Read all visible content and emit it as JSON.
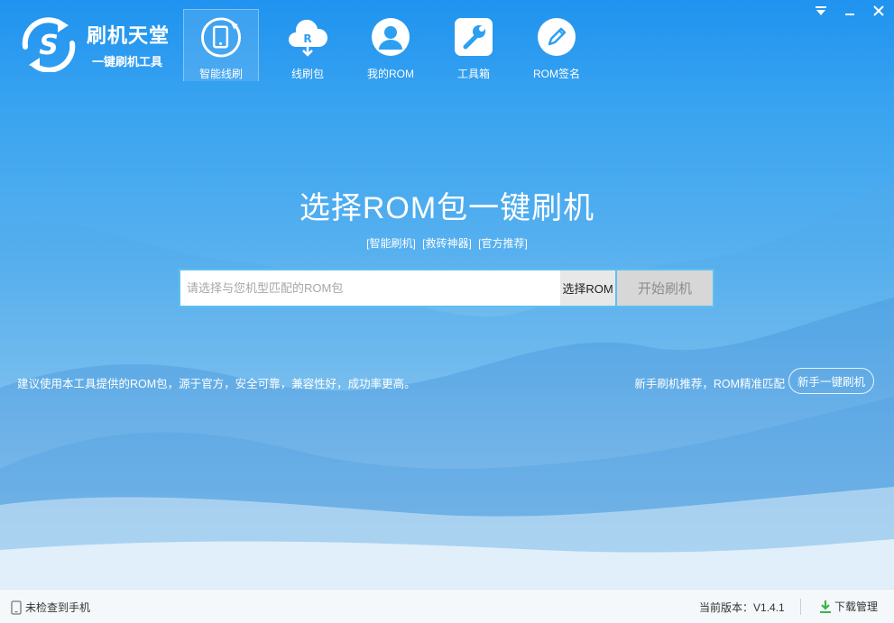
{
  "logo": {
    "title": "刷机天堂",
    "subtitle": "一键刷机工具"
  },
  "nav": [
    {
      "label": "智能线刷",
      "icon": "phone-refresh-icon"
    },
    {
      "label": "线刷包",
      "icon": "cloud-download-icon"
    },
    {
      "label": "我的ROM",
      "icon": "user-icon"
    },
    {
      "label": "工具箱",
      "icon": "wrench-icon"
    },
    {
      "label": "ROM签名",
      "icon": "pen-icon"
    }
  ],
  "main": {
    "headline": "选择ROM包一键刷机",
    "tags": [
      "[智能刷机]",
      "[救砖神器]",
      "[官方推荐]"
    ],
    "rom_placeholder": "请选择与您机型匹配的ROM包",
    "select_rom": "选择ROM",
    "start_flash": "开始刷机",
    "tip_left": "建议使用本工具提供的ROM包，源于官方，安全可靠，兼容性好，成功率更高。",
    "tip_right": "新手刷机推荐，ROM精准匹配",
    "newbie_button": "新手一键刷机"
  },
  "status": {
    "device": "未检查到手机",
    "version_label": "当前版本：",
    "version": "V1.4.1",
    "download": "下载管理"
  },
  "colors": {
    "accent": "#2d9ff0",
    "border": "#5ec0ef",
    "download_green": "#3cb44b"
  }
}
